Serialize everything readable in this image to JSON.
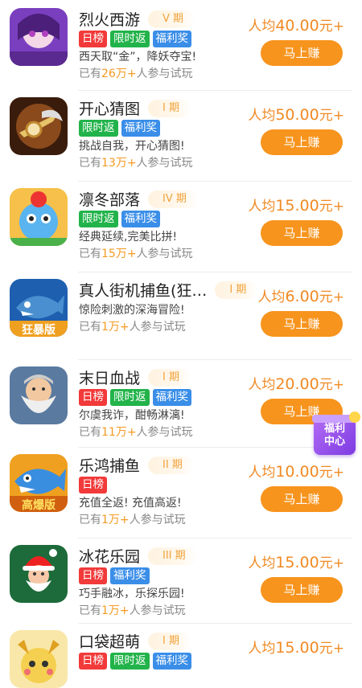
{
  "earn_button_label": "马上赚",
  "float_badge": {
    "line1": "福利",
    "line2": "中心"
  },
  "games": [
    {
      "title": "烈火西游",
      "period": "V 期",
      "tags": [
        {
          "label": "日榜",
          "color": "red"
        },
        {
          "label": "限时返",
          "color": "green"
        },
        {
          "label": "福利奖",
          "color": "blue"
        }
      ],
      "desc": "西天取“金”，降妖夺宝!",
      "users_prefix": "已有",
      "users_count": "26万+",
      "users_suffix": "人参与试玩",
      "reward_prefix": "人均",
      "reward_value": "40.00",
      "reward_suffix": "元+",
      "icon": "fire-journey-game-icon"
    },
    {
      "title": "开心猜图",
      "period": "I 期",
      "tags": [
        {
          "label": "限时返",
          "color": "green"
        },
        {
          "label": "福利奖",
          "color": "blue"
        }
      ],
      "desc": "挑战自我，开心猜图!",
      "users_prefix": "已有",
      "users_count": "13万+",
      "users_suffix": "人参与试玩",
      "reward_prefix": "人均",
      "reward_value": "50.00",
      "reward_suffix": "元+",
      "icon": "guess-picture-game-icon"
    },
    {
      "title": "凛冬部落",
      "period": "IV 期",
      "tags": [
        {
          "label": "限时返",
          "color": "green"
        },
        {
          "label": "福利奖",
          "color": "blue"
        }
      ],
      "desc": "经典延续,完美比拼!",
      "users_prefix": "已有",
      "users_count": "15万+",
      "users_suffix": "人参与试玩",
      "reward_prefix": "人均",
      "reward_value": "15.00",
      "reward_suffix": "元+",
      "icon": "winter-tribe-game-icon"
    },
    {
      "title": "真人街机捕鱼(狂…",
      "period": "I 期",
      "tags": [],
      "desc": "惊险刺激的深海冒险!",
      "users_prefix": "已有",
      "users_count": "1万+",
      "users_suffix": "人参与试玩",
      "reward_prefix": "人均",
      "reward_value": "6.00",
      "reward_suffix": "元+",
      "icon": "arcade-fishing-game-icon"
    },
    {
      "title": "末日血战",
      "period": "I 期",
      "tags": [
        {
          "label": "日榜",
          "color": "red"
        },
        {
          "label": "限时返",
          "color": "green"
        },
        {
          "label": "福利奖",
          "color": "blue"
        }
      ],
      "desc": "尔虞我诈，酣畅淋漓!",
      "users_prefix": "已有",
      "users_count": "11万+",
      "users_suffix": "人参与试玩",
      "reward_prefix": "人均",
      "reward_value": "20.00",
      "reward_suffix": "元+",
      "icon": "doomsday-battle-game-icon"
    },
    {
      "title": "乐鸿捕鱼",
      "period": "II 期",
      "tags": [
        {
          "label": "日榜",
          "color": "red"
        }
      ],
      "desc": "充值全返! 充值高返!",
      "users_prefix": "已有",
      "users_count": "1万+",
      "users_suffix": "人参与试玩",
      "reward_prefix": "人均",
      "reward_value": "10.00",
      "reward_suffix": "元+",
      "icon": "lehong-fishing-game-icon"
    },
    {
      "title": "冰花乐园",
      "period": "III 期",
      "tags": [
        {
          "label": "日榜",
          "color": "red"
        },
        {
          "label": "福利奖",
          "color": "blue"
        }
      ],
      "desc": "巧手融冰，乐探乐园!",
      "users_prefix": "已有",
      "users_count": "1万+",
      "users_suffix": "人参与试玩",
      "reward_prefix": "人均",
      "reward_value": "15.00",
      "reward_suffix": "元+",
      "icon": "ice-flower-park-game-icon"
    },
    {
      "title": "口袋超萌",
      "period": "I 期",
      "tags": [
        {
          "label": "日榜",
          "color": "red"
        },
        {
          "label": "限时返",
          "color": "green"
        },
        {
          "label": "福利奖",
          "color": "blue"
        }
      ],
      "desc": "",
      "users_prefix": "",
      "users_count": "",
      "users_suffix": "",
      "reward_prefix": "人均",
      "reward_value": "15.00",
      "reward_suffix": "元+",
      "icon": "pocket-cute-game-icon"
    }
  ]
}
